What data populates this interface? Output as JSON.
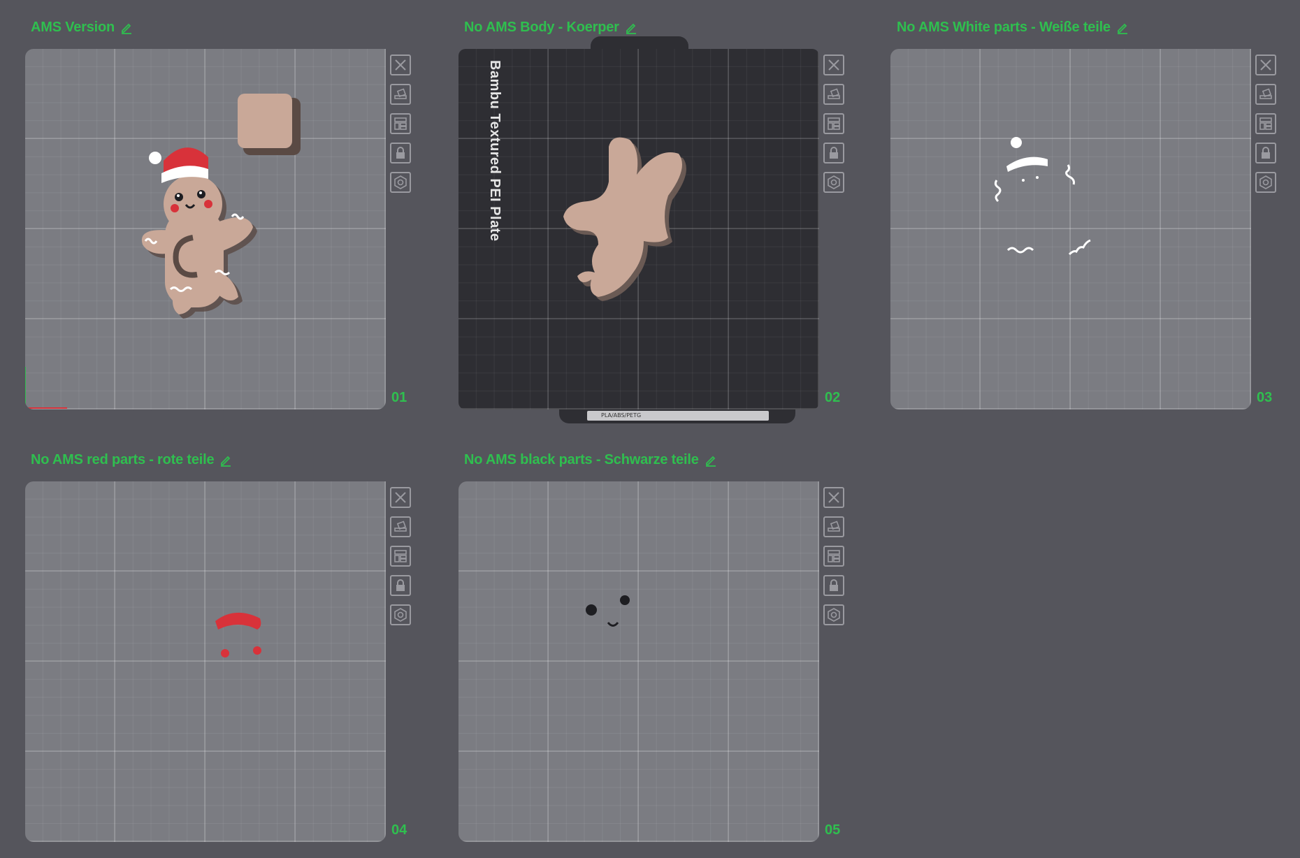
{
  "plates": [
    {
      "id": "plate-1",
      "name": "AMS Version",
      "number": "01"
    },
    {
      "id": "plate-2",
      "name": "No AMS Body - Koerper",
      "number": "02",
      "plate_label": "Bambu Textured PEI Plate",
      "plate_strip": "PLA/ABS/PETG"
    },
    {
      "id": "plate-3",
      "name": "No AMS White parts - Weiße teile",
      "number": "03"
    },
    {
      "id": "plate-4",
      "name": "No AMS red parts - rote teile",
      "number": "04"
    },
    {
      "id": "plate-5",
      "name": "No AMS black parts - Schwarze teile",
      "number": "05"
    }
  ],
  "toolbar_icons": [
    "close-icon",
    "auto-orient-icon",
    "arrange-icon",
    "lock-icon",
    "settings-icon"
  ],
  "colors": {
    "accent": "#2fbf4f",
    "background": "#55555c",
    "plate": "#7b7c82",
    "textured_plate": "#2e2e33",
    "body": "#c9a898",
    "red": "#d8323a",
    "white": "#ffffff",
    "black": "#1e1e22"
  }
}
